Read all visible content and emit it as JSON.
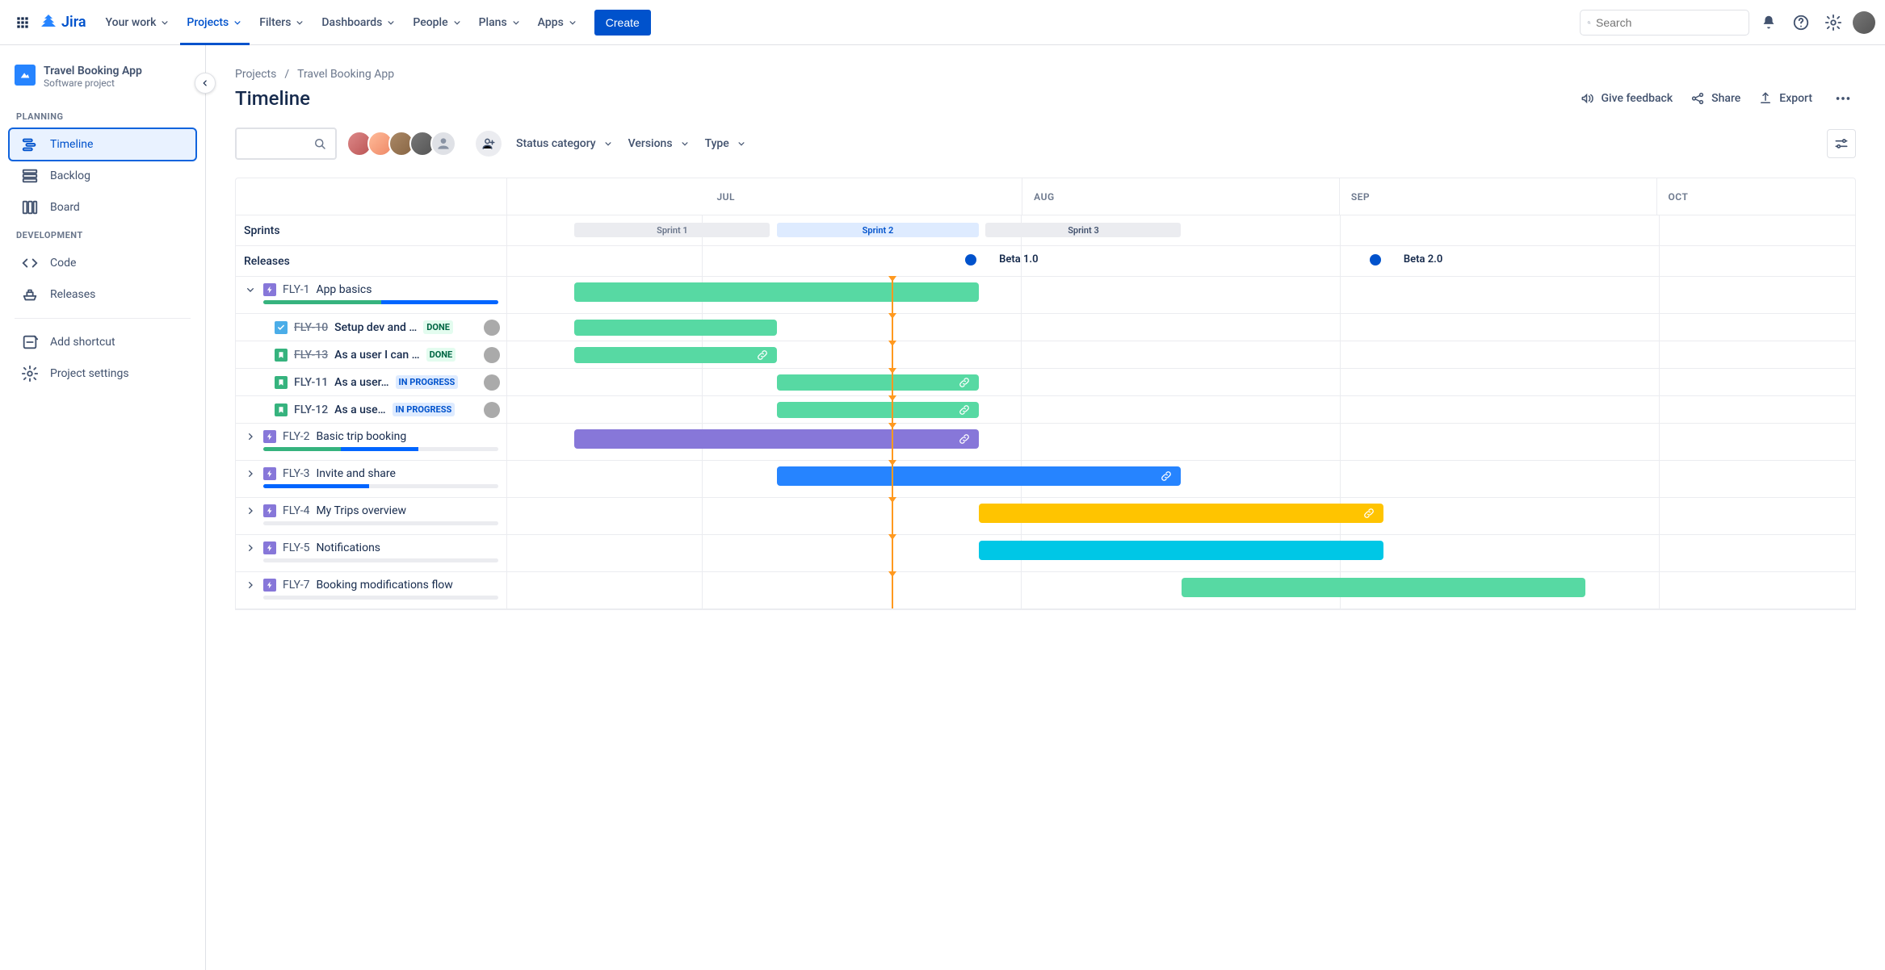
{
  "brand": "Jira",
  "nav": {
    "your_work": "Your work",
    "projects": "Projects",
    "filters": "Filters",
    "dashboards": "Dashboards",
    "people": "People",
    "plans": "Plans",
    "apps": "Apps",
    "create": "Create"
  },
  "search": {
    "placeholder": "Search"
  },
  "project": {
    "name": "Travel Booking App",
    "type": "Software project"
  },
  "sidebar": {
    "group_planning": "PLANNING",
    "group_development": "DEVELOPMENT",
    "timeline": "Timeline",
    "backlog": "Backlog",
    "board": "Board",
    "code": "Code",
    "releases": "Releases",
    "add_shortcut": "Add shortcut",
    "project_settings": "Project settings"
  },
  "breadcrumb": {
    "projects": "Projects",
    "project": "Travel Booking App"
  },
  "page": {
    "title": "Timeline"
  },
  "actions": {
    "feedback": "Give feedback",
    "share": "Share",
    "export": "Export"
  },
  "filters": {
    "status_category": "Status category",
    "versions": "Versions",
    "type": "Type"
  },
  "months": {
    "jul": "JUL",
    "aug": "AUG",
    "sep": "SEP",
    "oct": "OCT"
  },
  "rows": {
    "sprints": "Sprints",
    "releases": "Releases"
  },
  "sprints": {
    "s1": "Sprint 1",
    "s2": "Sprint 2",
    "s3": "Sprint 3"
  },
  "releases_list": {
    "beta1": "Beta 1.0",
    "beta2": "Beta 2.0"
  },
  "status": {
    "done": "DONE",
    "in_progress": "IN PROGRESS"
  },
  "epics": [
    {
      "key": "FLY-1",
      "title": "App basics",
      "expanded": true,
      "progress": {
        "green": 50,
        "blue": 50,
        "gray": 0
      },
      "bar": {
        "color": "green",
        "left_pct": 5,
        "width_pct": 30
      },
      "children": [
        {
          "key": "FLY-10",
          "title": "Setup dev and …",
          "type": "task",
          "status": "done",
          "bar": {
            "left_pct": 5,
            "width_pct": 15
          }
        },
        {
          "key": "FLY-13",
          "title": "As a user I can …",
          "type": "story",
          "status": "done",
          "bar": {
            "left_pct": 5,
            "width_pct": 15,
            "link": true
          }
        },
        {
          "key": "FLY-11",
          "title": "As a user…",
          "type": "story",
          "status": "in_progress",
          "bar": {
            "left_pct": 20,
            "width_pct": 15,
            "link": true
          }
        },
        {
          "key": "FLY-12",
          "title": "As a use…",
          "type": "story",
          "status": "in_progress",
          "bar": {
            "left_pct": 20,
            "width_pct": 15,
            "link": true
          }
        }
      ]
    },
    {
      "key": "FLY-2",
      "title": "Basic trip booking",
      "expanded": false,
      "progress": {
        "green": 33,
        "blue": 33,
        "gray": 34
      },
      "bar": {
        "color": "purple",
        "left_pct": 5,
        "width_pct": 30,
        "link": true
      }
    },
    {
      "key": "FLY-3",
      "title": "Invite and share",
      "expanded": false,
      "progress": {
        "green": 0,
        "blue": 45,
        "gray": 55
      },
      "bar": {
        "color": "blue",
        "left_pct": 20,
        "width_pct": 30,
        "link": true
      }
    },
    {
      "key": "FLY-4",
      "title": "My Trips overview",
      "expanded": false,
      "progress": {
        "green": 0,
        "blue": 0,
        "gray": 100
      },
      "bar": {
        "color": "yellow",
        "left_pct": 35,
        "width_pct": 30,
        "link": true
      }
    },
    {
      "key": "FLY-5",
      "title": "Notifications",
      "expanded": false,
      "progress": {
        "green": 0,
        "blue": 0,
        "gray": 100
      },
      "bar": {
        "color": "cyan",
        "left_pct": 35,
        "width_pct": 30
      }
    },
    {
      "key": "FLY-7",
      "title": "Booking modifications flow",
      "expanded": false,
      "progress": {
        "green": 0,
        "blue": 0,
        "gray": 100
      },
      "bar": {
        "color": "green",
        "left_pct": 50,
        "width_pct": 30
      }
    }
  ],
  "now_marker_pct": 28.5
}
